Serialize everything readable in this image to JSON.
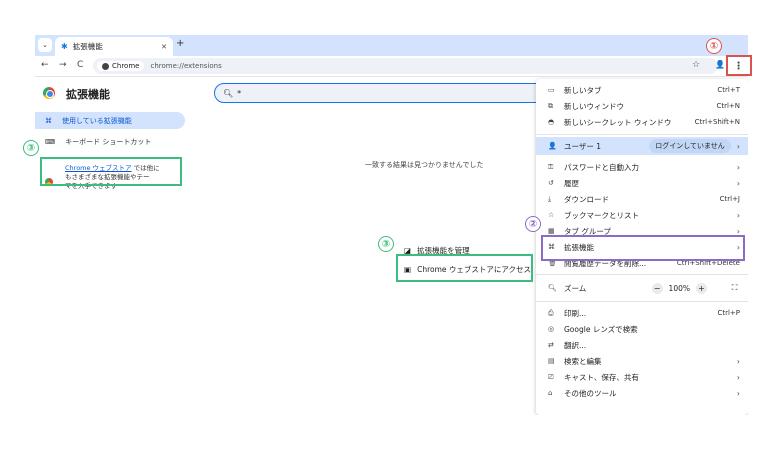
{
  "tab": {
    "title": "拡張機能",
    "close": "✕",
    "new_tab": "+",
    "menu": "⌄"
  },
  "toolbar": {
    "back": "←",
    "forward": "→",
    "reload": "C",
    "chip_label": "Chrome",
    "url": "chrome://extensions",
    "star": "☆",
    "kebab": "⋮"
  },
  "page": {
    "title": "拡張機能",
    "search_value": "*",
    "sidebar": {
      "active_item": "使用している拡張機能",
      "shortcuts_item": "キーボード ショートカット",
      "store_link": "Chrome ウェブストア",
      "store_text_1": "では他に",
      "store_text_2": "もさまざまな拡張機能やテー",
      "store_text_3": "マを入手できます"
    },
    "no_match": "一致する結果は見つかりませんでした"
  },
  "submenu": {
    "manage": "拡張機能を管理",
    "store": "Chrome ウェブストアにアクセス"
  },
  "menu": {
    "new_tab": {
      "label": "新しいタブ",
      "shortcut": "Ctrl+T"
    },
    "new_window": {
      "label": "新しいウィンドウ",
      "shortcut": "Ctrl+N"
    },
    "incognito": {
      "label": "新しいシークレット ウィンドウ",
      "shortcut": "Ctrl+Shift+N"
    },
    "user": {
      "label": "ユーザー 1",
      "status": "ログインしていません"
    },
    "passwords": {
      "label": "パスワードと自動入力"
    },
    "history": {
      "label": "履歴"
    },
    "downloads": {
      "label": "ダウンロード",
      "shortcut": "Ctrl+J"
    },
    "bookmarks": {
      "label": "ブックマークとリスト"
    },
    "tab_groups": {
      "label": "タブ グループ"
    },
    "extensions": {
      "label": "拡張機能"
    },
    "clear_data": {
      "label": "閲覧履歴データを削除...",
      "shortcut": "Ctrl+Shift+Delete"
    },
    "zoom": {
      "label": "ズーム",
      "minus": "−",
      "value": "100%",
      "plus": "+",
      "fullscreen": "⛶"
    },
    "print": {
      "label": "印刷...",
      "shortcut": "Ctrl+P"
    },
    "lens": {
      "label": "Google レンズで検索"
    },
    "translate": {
      "label": "翻訳..."
    },
    "find_edit": {
      "label": "検索と編集"
    },
    "cast": {
      "label": "キャスト、保存、共有"
    },
    "more_tools": {
      "label": "その他のツール"
    }
  },
  "annotations": {
    "n1": "①",
    "n2": "②",
    "n3a": "③",
    "n3b": "③"
  },
  "colors": {
    "red": "#d9534f",
    "purple": "#8e6ac8",
    "green": "#3dbd7d",
    "accent": "#1a73e8"
  }
}
